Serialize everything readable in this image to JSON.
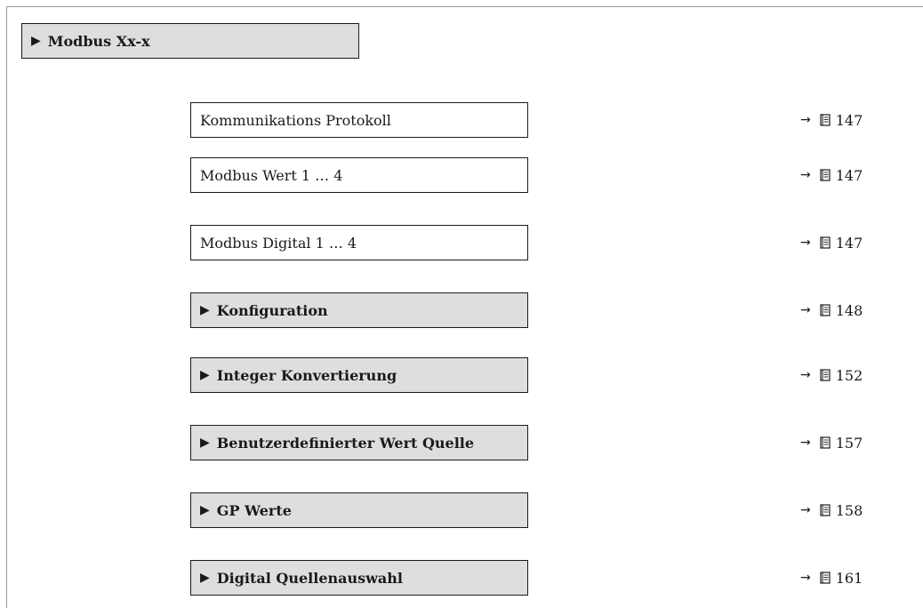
{
  "root": {
    "label": "Modbus Xx-x"
  },
  "items": [
    {
      "label": "Kommunikations Protokoll",
      "type": "parameter",
      "page": "147"
    },
    {
      "label": "Modbus Wert 1 … 4",
      "type": "parameter",
      "page": "147"
    },
    {
      "label": "Modbus Digital 1 … 4",
      "type": "parameter",
      "page": "147"
    },
    {
      "label": "Konfiguration",
      "type": "submenu",
      "page": "148"
    },
    {
      "label": "Integer Konvertierung",
      "type": "submenu",
      "page": "152"
    },
    {
      "label": "Benutzerdefinierter Wert Quelle",
      "type": "submenu",
      "page": "157"
    },
    {
      "label": "GP Werte",
      "type": "submenu",
      "page": "158"
    },
    {
      "label": "Digital Quellenauswahl",
      "type": "submenu",
      "page": "161"
    }
  ],
  "icons": {
    "submenu_marker": "triangle-right-icon",
    "reference_arrow": "arrow-right-icon",
    "page_reference": "book-icon"
  }
}
